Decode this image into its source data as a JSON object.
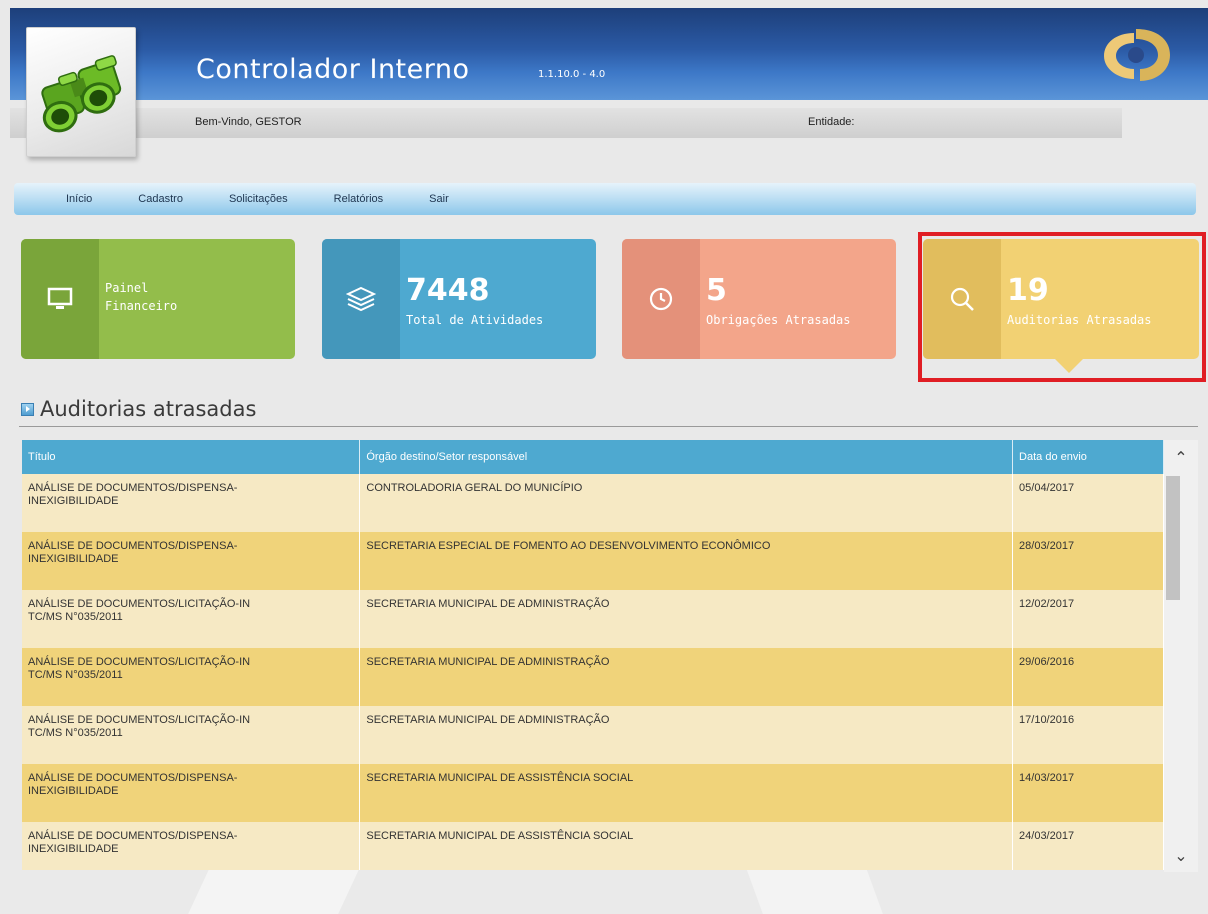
{
  "header": {
    "app_title": "Controlador Interno",
    "app_version": "1.1.10.0 - 4.0",
    "welcome": "Bem-Vindo, GESTOR",
    "entity_label": "Entidade:"
  },
  "nav": {
    "items": [
      "Início",
      "Cadastro",
      "Solicitações",
      "Relatórios",
      "Sair"
    ]
  },
  "tiles": {
    "financial": {
      "line1": "Painel",
      "line2": "Financeiro",
      "icon": "monitor-icon",
      "color": "#93bd4b"
    },
    "activities": {
      "value": "7448",
      "label": "Total de Atividades",
      "icon": "layers-icon",
      "color": "#4ea9d0"
    },
    "obligations": {
      "value": "5",
      "label": "Obrigações Atrasadas",
      "icon": "clock-icon",
      "color": "#f3a58a"
    },
    "audits": {
      "value": "19",
      "label": "Auditorias Atrasadas",
      "icon": "search-icon",
      "color": "#f2d173"
    }
  },
  "section": {
    "title": "Auditorias atrasadas"
  },
  "table": {
    "columns": [
      "Título",
      "Órgão destino/Setor responsável",
      "Data do envio"
    ],
    "rows": [
      {
        "title_l1": "ANÁLISE DE DOCUMENTOS/DISPENSA-",
        "title_l2": "INEXIGIBILIDADE",
        "org": "CONTROLADORIA GERAL DO MUNICÍPIO",
        "date": "05/04/2017"
      },
      {
        "title_l1": "ANÁLISE DE DOCUMENTOS/DISPENSA-",
        "title_l2": "INEXIGIBILIDADE",
        "org": "SECRETARIA ESPECIAL DE FOMENTO AO DESENVOLVIMENTO ECONÔMICO",
        "date": "28/03/2017"
      },
      {
        "title_l1": "ANÁLISE DE DOCUMENTOS/LICITAÇÃO-IN",
        "title_l2": "TC/MS N°035/2011",
        "org": "SECRETARIA MUNICIPAL DE ADMINISTRAÇÃO",
        "date": "12/02/2017"
      },
      {
        "title_l1": "ANÁLISE DE DOCUMENTOS/LICITAÇÃO-IN",
        "title_l2": "TC/MS N°035/2011",
        "org": "SECRETARIA MUNICIPAL DE ADMINISTRAÇÃO",
        "date": "29/06/2016"
      },
      {
        "title_l1": "ANÁLISE DE DOCUMENTOS/LICITAÇÃO-IN",
        "title_l2": "TC/MS N°035/2011",
        "org": "SECRETARIA MUNICIPAL DE ADMINISTRAÇÃO",
        "date": "17/10/2016"
      },
      {
        "title_l1": "ANÁLISE DE DOCUMENTOS/DISPENSA-",
        "title_l2": "INEXIGIBILIDADE",
        "org": "SECRETARIA MUNICIPAL DE ASSISTÊNCIA SOCIAL",
        "date": "14/03/2017"
      },
      {
        "title_l1": "ANÁLISE DE DOCUMENTOS/DISPENSA-",
        "title_l2": "INEXIGIBILIDADE",
        "org": "SECRETARIA MUNICIPAL DE ASSISTÊNCIA SOCIAL",
        "date": "24/03/2017"
      }
    ]
  },
  "colors": {
    "header_blue": "#2b5aa5",
    "table_header": "#4ea9d0",
    "row_light": "#f6e9c4",
    "row_dark": "#f0d37a",
    "highlight": "#e01e24"
  }
}
